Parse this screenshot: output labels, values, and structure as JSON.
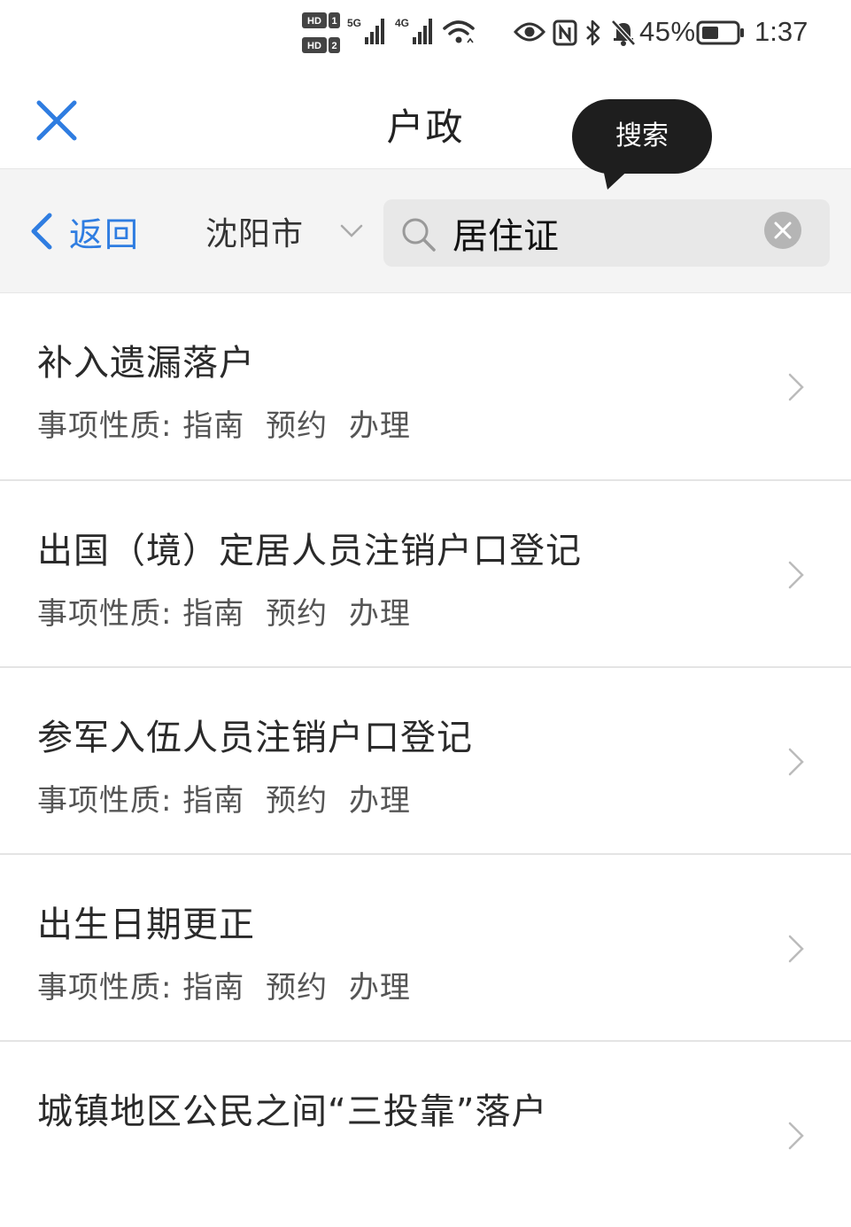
{
  "status_bar": {
    "hd1": "HD 1",
    "hd2": "HD 2",
    "sim1_network": "5G",
    "sim2_network": "4G",
    "battery_percent": "45%",
    "time": "1:37",
    "icons": [
      "hd-icon",
      "signal-icon",
      "signal-icon",
      "wifi-icon",
      "eye-icon",
      "nfc-icon",
      "bluetooth-icon",
      "bell-muted-icon",
      "battery-icon"
    ]
  },
  "header": {
    "title": "户政",
    "close_icon": "close-icon",
    "accent_color": "#2f7de1"
  },
  "tooltip": {
    "label": "搜索"
  },
  "toolbar": {
    "back_label": "返回",
    "city": "沈阳市",
    "search_value": "居住证",
    "search_placeholder": ""
  },
  "results": [
    {
      "title": "补入遗漏落户",
      "meta_label": "事项性质:",
      "tags": [
        "指南",
        "预约",
        "办理"
      ]
    },
    {
      "title": "出国（境）定居人员注销户口登记",
      "meta_label": "事项性质:",
      "tags": [
        "指南",
        "预约",
        "办理"
      ]
    },
    {
      "title": "参军入伍人员注销户口登记",
      "meta_label": "事项性质:",
      "tags": [
        "指南",
        "预约",
        "办理"
      ]
    },
    {
      "title": "出生日期更正",
      "meta_label": "事项性质:",
      "tags": [
        "指南",
        "预约",
        "办理"
      ]
    },
    {
      "title": "城镇地区公民之间“三投靠”落户",
      "meta_label": "",
      "tags": []
    }
  ]
}
